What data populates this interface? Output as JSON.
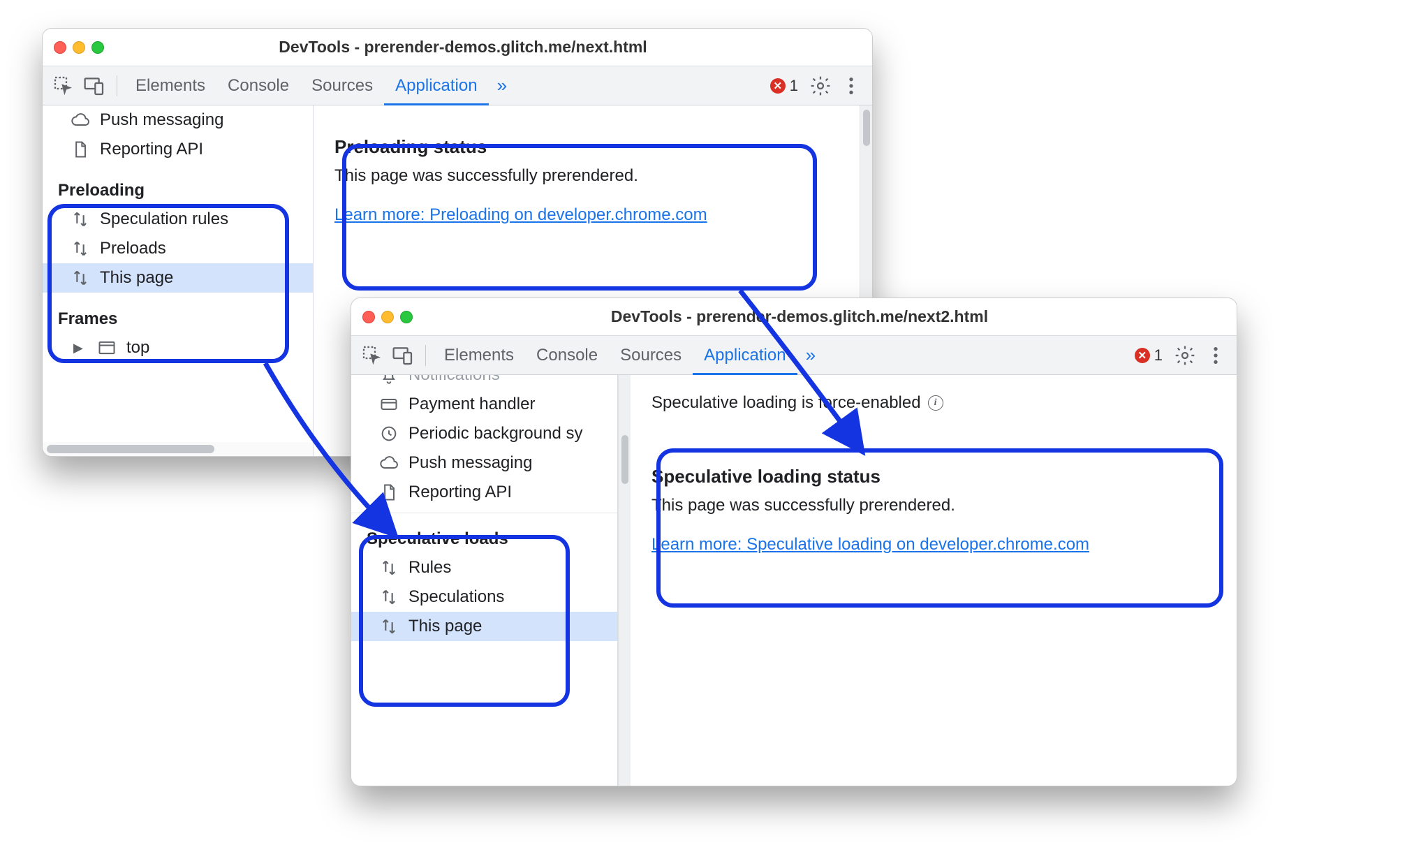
{
  "win1": {
    "title": "DevTools - prerender-demos.glitch.me/next.html",
    "tabs": {
      "elements": "Elements",
      "console": "Console",
      "sources": "Sources",
      "application": "Application"
    },
    "errors_count": "1",
    "sidebar": {
      "push": "Push messaging",
      "reporting": "Reporting API",
      "section": "Preloading",
      "rules": "Speculation rules",
      "preloads": "Preloads",
      "thispage": "This page",
      "frames": "Frames",
      "top": "top"
    },
    "panel": {
      "heading": "Preloading status",
      "body": "This page was successfully prerendered.",
      "link": "Learn more: Preloading on developer.chrome.com"
    }
  },
  "win2": {
    "title": "DevTools - prerender-demos.glitch.me/next2.html",
    "tabs": {
      "elements": "Elements",
      "console": "Console",
      "sources": "Sources",
      "application": "Application"
    },
    "errors_count": "1",
    "sidebar": {
      "notifications": "Notifications",
      "payment": "Payment handler",
      "periodic": "Periodic background sy",
      "push": "Push messaging",
      "reporting": "Reporting API",
      "section": "Speculative loads",
      "rules": "Rules",
      "speculations": "Speculations",
      "thispage": "This page"
    },
    "panel": {
      "topline": "Speculative loading is force-enabled",
      "heading": "Speculative loading status",
      "body": "This page was successfully prerendered.",
      "link": "Learn more: Speculative loading on developer.chrome.com"
    }
  }
}
